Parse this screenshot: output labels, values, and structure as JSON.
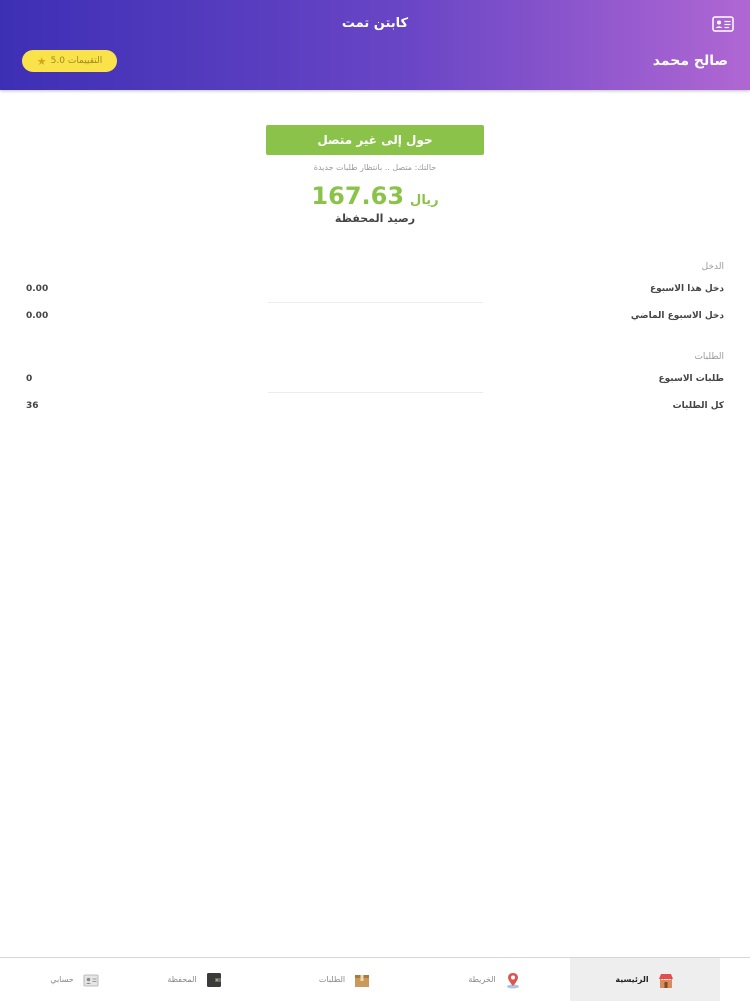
{
  "header": {
    "title": "كابتن تمت",
    "driver_name": "صالح محمد",
    "rating": "5.0 التقييمات",
    "id_icon": "id-card-icon"
  },
  "status": {
    "toggle_label": "حول إلى غير متصل",
    "status_text": "حالتك: متصل .. بانتظار طلبات جديدة"
  },
  "wallet": {
    "amount": "167.63",
    "currency": "ريال",
    "label": "رصيد المحفظة"
  },
  "income": {
    "section_title": "الدخل",
    "rows": [
      {
        "label": "دخل هذا الاسبوع",
        "value": "0.00"
      },
      {
        "label": "دخل الاسبوع الماضي",
        "value": "0.00"
      }
    ]
  },
  "orders": {
    "section_title": "الطلبات",
    "rows": [
      {
        "label": "طلبات الاسبوع",
        "value": "0"
      },
      {
        "label": "كل الطلبات",
        "value": "36"
      }
    ]
  },
  "tabbar": {
    "items": [
      {
        "label": "الرئيسية",
        "icon": "home-store-icon",
        "active": true
      },
      {
        "label": "الخريطة",
        "icon": "map-pin-icon",
        "active": false
      },
      {
        "label": "الطلبات",
        "icon": "package-box-icon",
        "active": false
      },
      {
        "label": "المحفظة",
        "icon": "wallet-icon",
        "active": false
      },
      {
        "label": "حسابي",
        "icon": "account-card-icon",
        "active": false
      }
    ]
  },
  "colors": {
    "header_start": "#3d2fb5",
    "header_end": "#b067d3",
    "accent_green": "#8bc34a",
    "rating_yellow": "#f9e24a"
  }
}
